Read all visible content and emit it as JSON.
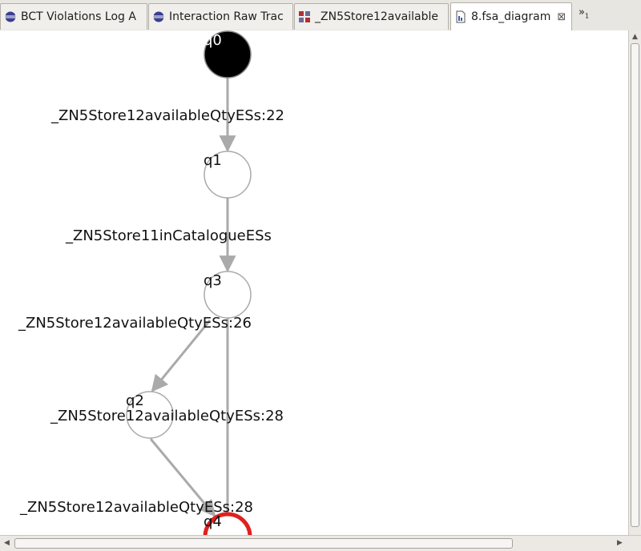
{
  "tabs": [
    {
      "label": "BCT Violations Log A",
      "icon": "eclipse-icon",
      "active": false
    },
    {
      "label": "Interaction Raw Trac",
      "icon": "eclipse-icon",
      "active": false
    },
    {
      "label": "_ZN5Store12available",
      "icon": "fsa-editor-icon",
      "active": false
    },
    {
      "label": "8.fsa_diagram",
      "icon": "diagram-file-icon",
      "active": true,
      "close": "⊠"
    }
  ],
  "overflow": {
    "symbol": "»",
    "count": "1"
  },
  "diagram": {
    "states": [
      {
        "id": "q0",
        "label": "q0",
        "kind": "initial"
      },
      {
        "id": "q1",
        "label": "q1",
        "kind": "normal"
      },
      {
        "id": "q3",
        "label": "q3",
        "kind": "normal"
      },
      {
        "id": "q2",
        "label": "q2",
        "kind": "normal"
      },
      {
        "id": "q4",
        "label": "q4",
        "kind": "final"
      }
    ],
    "transitions": [
      {
        "from": "q0",
        "to": "q1",
        "label": "_ZN5Store12availableQtyESs:22"
      },
      {
        "from": "q1",
        "to": "q3",
        "label": "_ZN5Store11inCatalogueESs"
      },
      {
        "from": "q3",
        "to": "q2",
        "label": "_ZN5Store12availableQtyESs:26"
      },
      {
        "from": "q3",
        "to": "q4",
        "label": "_ZN5Store12availableQtyESs:28"
      },
      {
        "from": "q2",
        "to": "q4",
        "label": "_ZN5Store12availableQtyESs:28"
      }
    ]
  },
  "colors": {
    "initial_fill": "#000000",
    "final_stroke": "#e02020",
    "edge": "#aaaaaa"
  }
}
